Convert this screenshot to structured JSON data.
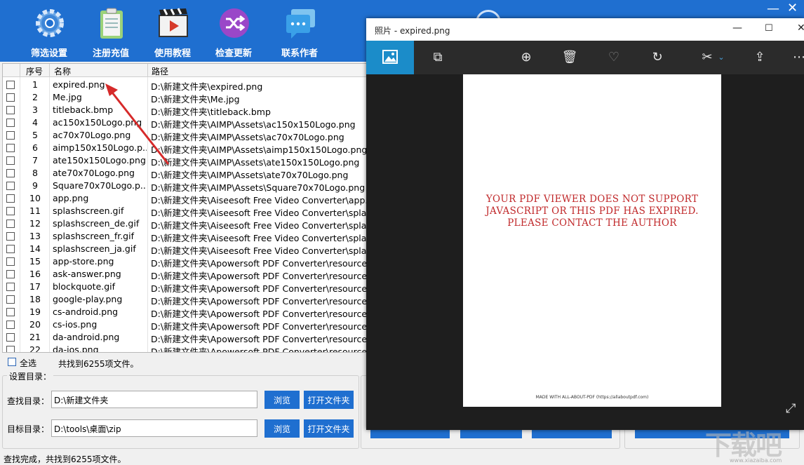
{
  "toolbar": {
    "buttons": [
      {
        "label": "筛选设置",
        "icon": "gear-icon"
      },
      {
        "label": "注册充值",
        "icon": "clipboard-icon"
      },
      {
        "label": "使用教程",
        "icon": "video-icon"
      },
      {
        "label": "检查更新",
        "icon": "shuffle-icon"
      },
      {
        "label": "联系作者",
        "icon": "chat-icon"
      }
    ]
  },
  "table": {
    "columns": [
      "序号",
      "名称",
      "路径"
    ],
    "rows": [
      {
        "no": "1",
        "name": "expired.png",
        "path": "D:\\新建文件夹\\expired.png"
      },
      {
        "no": "2",
        "name": "Me.jpg",
        "path": "D:\\新建文件夹\\Me.jpg"
      },
      {
        "no": "3",
        "name": "titleback.bmp",
        "path": "D:\\新建文件夹\\titleback.bmp"
      },
      {
        "no": "4",
        "name": "ac150x150Logo.png",
        "path": "D:\\新建文件夹\\AIMP\\Assets\\ac150x150Logo.png"
      },
      {
        "no": "5",
        "name": "ac70x70Logo.png",
        "path": "D:\\新建文件夹\\AIMP\\Assets\\ac70x70Logo.png"
      },
      {
        "no": "6",
        "name": "aimp150x150Logo.p...",
        "path": "D:\\新建文件夹\\AIMP\\Assets\\aimp150x150Logo.png"
      },
      {
        "no": "7",
        "name": "ate150x150Logo.png",
        "path": "D:\\新建文件夹\\AIMP\\Assets\\ate150x150Logo.png"
      },
      {
        "no": "8",
        "name": "ate70x70Logo.png",
        "path": "D:\\新建文件夹\\AIMP\\Assets\\ate70x70Logo.png"
      },
      {
        "no": "9",
        "name": "Square70x70Logo.p...",
        "path": "D:\\新建文件夹\\AIMP\\Assets\\Square70x70Logo.png"
      },
      {
        "no": "10",
        "name": "app.png",
        "path": "D:\\新建文件夹\\Aiseesoft Free Video Converter\\app.pr"
      },
      {
        "no": "11",
        "name": "splashscreen.gif",
        "path": "D:\\新建文件夹\\Aiseesoft Free Video Converter\\splash"
      },
      {
        "no": "12",
        "name": "splashscreen_de.gif",
        "path": "D:\\新建文件夹\\Aiseesoft Free Video Converter\\splash"
      },
      {
        "no": "13",
        "name": "splashscreen_fr.gif",
        "path": "D:\\新建文件夹\\Aiseesoft Free Video Converter\\splash"
      },
      {
        "no": "14",
        "name": "splashscreen_ja.gif",
        "path": "D:\\新建文件夹\\Aiseesoft Free Video Converter\\splash"
      },
      {
        "no": "15",
        "name": "app-store.png",
        "path": "D:\\新建文件夹\\Apowersoft PDF Converter\\resources\\c"
      },
      {
        "no": "16",
        "name": "ask-answer.png",
        "path": "D:\\新建文件夹\\Apowersoft PDF Converter\\resources\\c"
      },
      {
        "no": "17",
        "name": "blockquote.gif",
        "path": "D:\\新建文件夹\\Apowersoft PDF Converter\\resources\\c"
      },
      {
        "no": "18",
        "name": "google-play.png",
        "path": "D:\\新建文件夹\\Apowersoft PDF Converter\\resources\\c"
      },
      {
        "no": "19",
        "name": "cs-android.png",
        "path": "D:\\新建文件夹\\Apowersoft PDF Converter\\resources\\c"
      },
      {
        "no": "20",
        "name": "cs-ios.png",
        "path": "D:\\新建文件夹\\Apowersoft PDF Converter\\resources\\c"
      },
      {
        "no": "21",
        "name": "da-android.png",
        "path": "D:\\新建文件夹\\Apowersoft PDF Converter\\resources\\c"
      },
      {
        "no": "22",
        "name": "da-ios.png",
        "path": "D:\\新建文件夹\\Apowersoft PDF Converter\\resources\\c"
      }
    ]
  },
  "select_all_label": "全选",
  "found_text": "共找到6255项文件。",
  "settings": {
    "group_title": "设置目录：",
    "search_label": "查找目录：",
    "search_value": "D:\\新建文件夹",
    "target_label": "目标目录：",
    "target_value": "D:\\tools\\桌面\\zip",
    "browse_label": "浏览",
    "open_folder_label": "打开文件夹"
  },
  "status_text": "查找完成，共找到6255项文件。",
  "viewer": {
    "title": "照片 - expired.png",
    "message": [
      "YOUR PDF VIEWER DOES NOT SUPPORT",
      "JAVASCRIPT OR THIS PDF HAS EXPIRED.",
      "PLEASE CONTACT THE AUTHOR"
    ],
    "footer": "MADE WITH ALL-ABOUT-PDF (https://allaboutpdf.com)"
  },
  "colors": {
    "accent": "#1f6fd0",
    "viewer_bg": "#1e1e1e",
    "message_red": "#c0282a",
    "annotation_arrow": "#d62a2a"
  }
}
